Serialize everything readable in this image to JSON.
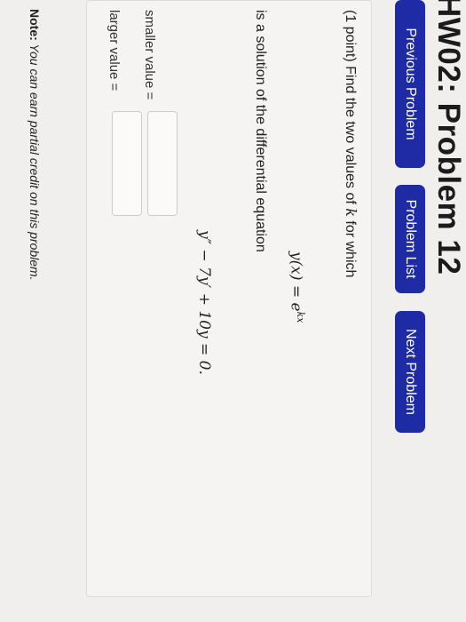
{
  "page": {
    "title": "HW02: Problem 12"
  },
  "nav": {
    "previous": "Previous Problem",
    "list": "Problem List",
    "next": "Next Problem"
  },
  "problem": {
    "prompt_prefix": "(1 point) Find the two values of ",
    "prompt_var": "k",
    "prompt_suffix": " for which",
    "eq1_lhs": "y(x) = e",
    "eq1_exp": "kx",
    "solution_text": "is a solution of the differential equation",
    "eq2": "y″ − 7y′ + 10y = 0."
  },
  "answers": {
    "smaller_label": "smaller value =",
    "smaller_value": "",
    "larger_label": "larger value =",
    "larger_value": ""
  },
  "note": {
    "label": "Note:",
    "text": " You can earn partial credit on this problem."
  },
  "colors": {
    "button_blue": "#1f2aa5",
    "background": "#f1efee"
  }
}
